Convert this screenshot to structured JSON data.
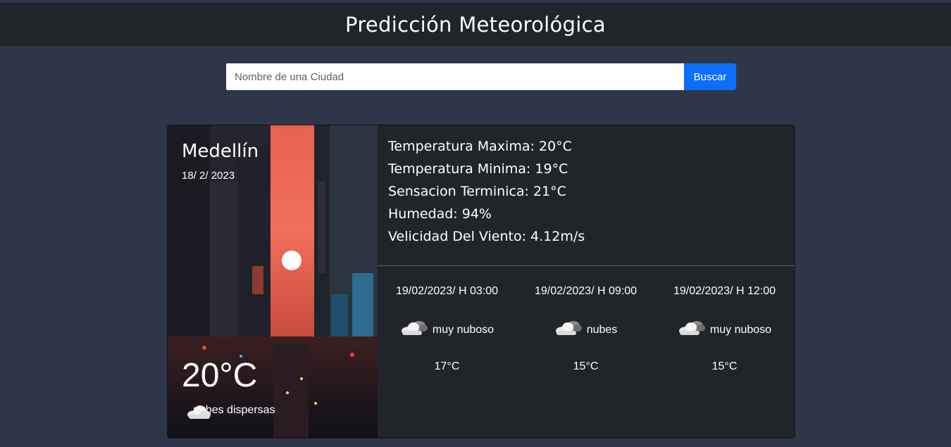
{
  "header": {
    "title": "Predicción Meteorológica"
  },
  "search": {
    "placeholder": "Nombre de una Ciudad",
    "value": "",
    "button_label": "Buscar"
  },
  "current": {
    "city": "Medellín",
    "date": "18/ 2/ 2023",
    "temperature": "20°C",
    "condition": "nubes dispersas",
    "condition_icon": "cloud-icon"
  },
  "details": [
    "Temperatura Maxima: 20°C",
    "Temperatura Minima: 19°C",
    "Sensacion Terminica: 21°C",
    "Humedad: 94%",
    "Velicidad Del Viento: 4.12m/s"
  ],
  "forecast": [
    {
      "time": "19/02/2023/ H 03:00",
      "condition": "muy nuboso",
      "icon": "broken-clouds-icon",
      "temp": "17°C"
    },
    {
      "time": "19/02/2023/ H 09:00",
      "condition": "nubes",
      "icon": "broken-clouds-icon",
      "temp": "15°C"
    },
    {
      "time": "19/02/2023/ H 12:00",
      "condition": "muy nuboso",
      "icon": "broken-clouds-icon",
      "temp": "15°C"
    }
  ],
  "colors": {
    "background": "#30364a",
    "header": "#212429",
    "card": "#212529",
    "button": "#0d6efd"
  }
}
